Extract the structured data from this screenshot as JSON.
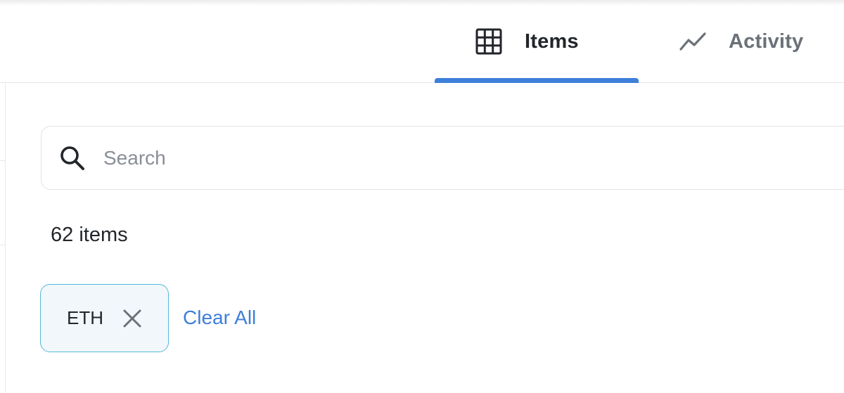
{
  "tabs": [
    {
      "label": "Items",
      "icon": "grid-icon",
      "active": true
    },
    {
      "label": "Activity",
      "icon": "activity-chart-icon",
      "active": false
    }
  ],
  "search": {
    "placeholder": "Search",
    "value": "",
    "icon": "search-icon"
  },
  "results": {
    "count_text": "62 items"
  },
  "filters": {
    "chips": [
      {
        "label": "ETH",
        "icon": "close-icon"
      }
    ],
    "clear_all_label": "Clear All"
  },
  "colors": {
    "accent": "#3d7fd9",
    "chip_border": "#56b9d6",
    "chip_background": "#f1f7fb",
    "active_tab_text": "#22262b",
    "inactive_tab_text": "#6b7178",
    "placeholder": "#8a8f96"
  }
}
